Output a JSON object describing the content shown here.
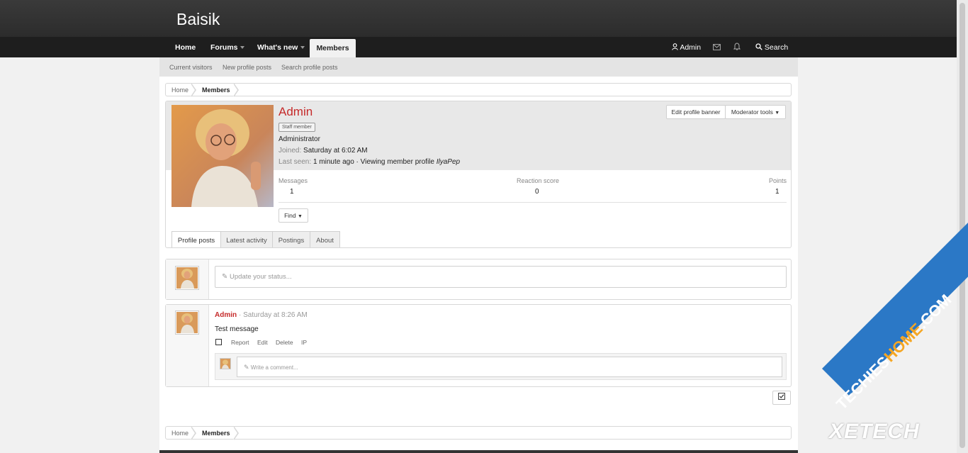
{
  "site": {
    "title": "Baisik"
  },
  "nav": {
    "items": [
      {
        "label": "Home"
      },
      {
        "label": "Forums"
      },
      {
        "label": "What's new"
      },
      {
        "label": "Members"
      }
    ],
    "account_label": "Admin",
    "search_label": "Search"
  },
  "subnav": {
    "items": [
      {
        "label": "Current visitors"
      },
      {
        "label": "New profile posts"
      },
      {
        "label": "Search profile posts"
      }
    ]
  },
  "breadcrumb": {
    "home": "Home",
    "current": "Members"
  },
  "profile": {
    "username": "Admin",
    "badge": "Staff member",
    "user_title": "Administrator",
    "joined_label": "Joined:",
    "joined_value": "Saturday at 6:02 AM",
    "last_seen_label": "Last seen:",
    "last_seen_value": "1 minute ago · Viewing member profile",
    "last_seen_target": "IlyaPep",
    "edit_banner_label": "Edit profile banner",
    "mod_tools_label": "Moderator tools",
    "stats": [
      {
        "label": "Messages",
        "value": "1"
      },
      {
        "label": "Reaction score",
        "value": "0"
      },
      {
        "label": "Points",
        "value": "1"
      }
    ],
    "find_label": "Find",
    "tabs": [
      {
        "label": "Profile posts"
      },
      {
        "label": "Latest activity"
      },
      {
        "label": "Postings"
      },
      {
        "label": "About"
      }
    ]
  },
  "status": {
    "placeholder": "Update your status..."
  },
  "post": {
    "author": "Admin",
    "time": "· Saturday at 8:26 AM",
    "message": "Test message",
    "actions": [
      "Report",
      "Edit",
      "Delete",
      "IP"
    ],
    "comment_placeholder": "Write a comment..."
  },
  "watermark": {
    "text1": "TECHIES",
    "text2": "HOME",
    "text3": ".COM",
    "text4": "XETECH"
  },
  "colors": {
    "accent": "#c52a2a",
    "header": "#2c2c2c",
    "nav": "#1e1e1e",
    "watermark": "#2b78c6"
  }
}
